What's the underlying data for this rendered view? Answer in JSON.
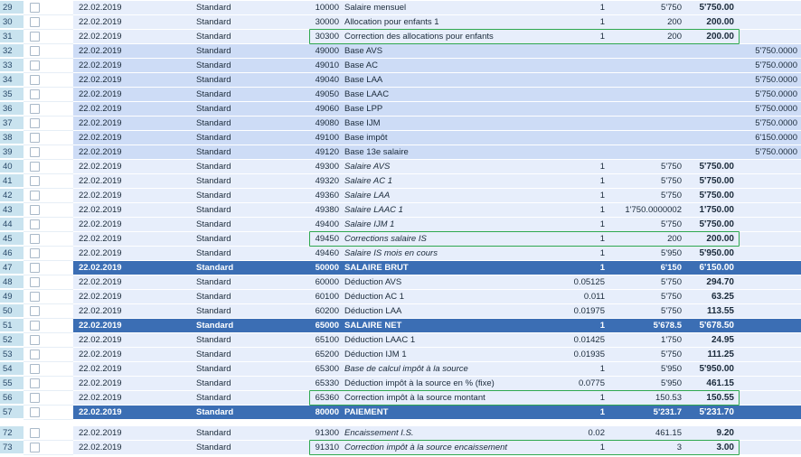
{
  "rows": [
    {
      "n": "29",
      "date": "22.02.2019",
      "type": "Standard",
      "code": "10000",
      "desc": "Salaire mensuel",
      "qty": "1",
      "rate": "5'750",
      "amt": "5'750.00",
      "base": "",
      "kind": "light",
      "italic": false,
      "hl": false
    },
    {
      "n": "30",
      "date": "22.02.2019",
      "type": "Standard",
      "code": "30000",
      "desc": "Allocation pour enfants 1",
      "qty": "1",
      "rate": "200",
      "amt": "200.00",
      "base": "",
      "kind": "light",
      "italic": false,
      "hl": false
    },
    {
      "n": "31",
      "date": "22.02.2019",
      "type": "Standard",
      "code": "30300",
      "desc": "Correction des allocations pour enfants",
      "qty": "1",
      "rate": "200",
      "amt": "200.00",
      "base": "",
      "kind": "light",
      "italic": false,
      "hl": true
    },
    {
      "n": "32",
      "date": "22.02.2019",
      "type": "Standard",
      "code": "49000",
      "desc": "Base AVS",
      "qty": "",
      "rate": "",
      "amt": "",
      "base": "5'750.0000",
      "kind": "blue",
      "italic": false,
      "hl": false
    },
    {
      "n": "33",
      "date": "22.02.2019",
      "type": "Standard",
      "code": "49010",
      "desc": "Base AC",
      "qty": "",
      "rate": "",
      "amt": "",
      "base": "5'750.0000",
      "kind": "blue",
      "italic": false,
      "hl": false
    },
    {
      "n": "34",
      "date": "22.02.2019",
      "type": "Standard",
      "code": "49040",
      "desc": "Base LAA",
      "qty": "",
      "rate": "",
      "amt": "",
      "base": "5'750.0000",
      "kind": "blue",
      "italic": false,
      "hl": false
    },
    {
      "n": "35",
      "date": "22.02.2019",
      "type": "Standard",
      "code": "49050",
      "desc": "Base LAAC",
      "qty": "",
      "rate": "",
      "amt": "",
      "base": "5'750.0000",
      "kind": "blue",
      "italic": false,
      "hl": false
    },
    {
      "n": "36",
      "date": "22.02.2019",
      "type": "Standard",
      "code": "49060",
      "desc": "Base LPP",
      "qty": "",
      "rate": "",
      "amt": "",
      "base": "5'750.0000",
      "kind": "blue",
      "italic": false,
      "hl": false
    },
    {
      "n": "37",
      "date": "22.02.2019",
      "type": "Standard",
      "code": "49080",
      "desc": "Base IJM",
      "qty": "",
      "rate": "",
      "amt": "",
      "base": "5'750.0000",
      "kind": "blue",
      "italic": false,
      "hl": false
    },
    {
      "n": "38",
      "date": "22.02.2019",
      "type": "Standard",
      "code": "49100",
      "desc": "Base impôt",
      "qty": "",
      "rate": "",
      "amt": "",
      "base": "6'150.0000",
      "kind": "blue",
      "italic": false,
      "hl": false
    },
    {
      "n": "39",
      "date": "22.02.2019",
      "type": "Standard",
      "code": "49120",
      "desc": "Base 13e salaire",
      "qty": "",
      "rate": "",
      "amt": "",
      "base": "5'750.0000",
      "kind": "blue",
      "italic": false,
      "hl": false
    },
    {
      "n": "40",
      "date": "22.02.2019",
      "type": "Standard",
      "code": "49300",
      "desc": "Salaire AVS",
      "qty": "1",
      "rate": "5'750",
      "amt": "5'750.00",
      "base": "",
      "kind": "light",
      "italic": true,
      "hl": false
    },
    {
      "n": "41",
      "date": "22.02.2019",
      "type": "Standard",
      "code": "49320",
      "desc": "Salaire AC 1",
      "qty": "1",
      "rate": "5'750",
      "amt": "5'750.00",
      "base": "",
      "kind": "light",
      "italic": true,
      "hl": false
    },
    {
      "n": "42",
      "date": "22.02.2019",
      "type": "Standard",
      "code": "49360",
      "desc": "Salaire LAA",
      "qty": "1",
      "rate": "5'750",
      "amt": "5'750.00",
      "base": "",
      "kind": "light",
      "italic": true,
      "hl": false
    },
    {
      "n": "43",
      "date": "22.02.2019",
      "type": "Standard",
      "code": "49380",
      "desc": "Salaire LAAC 1",
      "qty": "1",
      "rate": "1'750.0000002",
      "amt": "1'750.00",
      "base": "",
      "kind": "light",
      "italic": true,
      "hl": false
    },
    {
      "n": "44",
      "date": "22.02.2019",
      "type": "Standard",
      "code": "49400",
      "desc": "Salaire IJM 1",
      "qty": "1",
      "rate": "5'750",
      "amt": "5'750.00",
      "base": "",
      "kind": "light",
      "italic": true,
      "hl": false
    },
    {
      "n": "45",
      "date": "22.02.2019",
      "type": "Standard",
      "code": "49450",
      "desc": "Corrections salaire IS",
      "qty": "1",
      "rate": "200",
      "amt": "200.00",
      "base": "",
      "kind": "light",
      "italic": true,
      "hl": true
    },
    {
      "n": "46",
      "date": "22.02.2019",
      "type": "Standard",
      "code": "49460",
      "desc": "Salaire IS mois en cours",
      "qty": "1",
      "rate": "5'950",
      "amt": "5'950.00",
      "base": "",
      "kind": "light",
      "italic": true,
      "hl": false
    },
    {
      "n": "47",
      "date": "22.02.2019",
      "type": "Standard",
      "code": "50000",
      "desc": "SALAIRE BRUT",
      "qty": "1",
      "rate": "6'150",
      "amt": "6'150.00",
      "base": "",
      "kind": "total",
      "italic": false,
      "hl": false
    },
    {
      "n": "48",
      "date": "22.02.2019",
      "type": "Standard",
      "code": "60000",
      "desc": "Déduction AVS",
      "qty": "0.05125",
      "rate": "5'750",
      "amt": "294.70",
      "base": "",
      "kind": "light",
      "italic": false,
      "hl": false
    },
    {
      "n": "49",
      "date": "22.02.2019",
      "type": "Standard",
      "code": "60100",
      "desc": "Déduction AC 1",
      "qty": "0.011",
      "rate": "5'750",
      "amt": "63.25",
      "base": "",
      "kind": "light",
      "italic": false,
      "hl": false
    },
    {
      "n": "50",
      "date": "22.02.2019",
      "type": "Standard",
      "code": "60200",
      "desc": "Déduction LAA",
      "qty": "0.01975",
      "rate": "5'750",
      "amt": "113.55",
      "base": "",
      "kind": "light",
      "italic": false,
      "hl": false
    },
    {
      "n": "51",
      "date": "22.02.2019",
      "type": "Standard",
      "code": "65000",
      "desc": "SALAIRE NET",
      "qty": "1",
      "rate": "5'678.5",
      "amt": "5'678.50",
      "base": "",
      "kind": "total",
      "italic": false,
      "hl": false
    },
    {
      "n": "52",
      "date": "22.02.2019",
      "type": "Standard",
      "code": "65100",
      "desc": "Déduction LAAC 1",
      "qty": "0.01425",
      "rate": "1'750",
      "amt": "24.95",
      "base": "",
      "kind": "light",
      "italic": false,
      "hl": false
    },
    {
      "n": "53",
      "date": "22.02.2019",
      "type": "Standard",
      "code": "65200",
      "desc": "Déduction IJM 1",
      "qty": "0.01935",
      "rate": "5'750",
      "amt": "111.25",
      "base": "",
      "kind": "light",
      "italic": false,
      "hl": false
    },
    {
      "n": "54",
      "date": "22.02.2019",
      "type": "Standard",
      "code": "65300",
      "desc": "Base de calcul impôt à la source",
      "qty": "1",
      "rate": "5'950",
      "amt": "5'950.00",
      "base": "",
      "kind": "light",
      "italic": true,
      "hl": false
    },
    {
      "n": "55",
      "date": "22.02.2019",
      "type": "Standard",
      "code": "65330",
      "desc": "Déduction impôt à la source en % (fixe)",
      "qty": "0.0775",
      "rate": "5'950",
      "amt": "461.15",
      "base": "",
      "kind": "light",
      "italic": false,
      "hl": false
    },
    {
      "n": "56",
      "date": "22.02.2019",
      "type": "Standard",
      "code": "65360",
      "desc": "Correction impôt à la source montant",
      "qty": "1",
      "rate": "150.53",
      "amt": "150.55",
      "base": "",
      "kind": "light",
      "italic": false,
      "hl": true
    },
    {
      "n": "57",
      "date": "22.02.2019",
      "type": "Standard",
      "code": "80000",
      "desc": "PAIEMENT",
      "qty": "1",
      "rate": "5'231.7",
      "amt": "5'231.70",
      "base": "",
      "kind": "total",
      "italic": false,
      "hl": false
    },
    {
      "n": "72",
      "date": "22.02.2019",
      "type": "Standard",
      "code": "91300",
      "desc": "Encaissement I.S.",
      "qty": "0.02",
      "rate": "461.15",
      "amt": "9.20",
      "base": "",
      "kind": "light",
      "italic": true,
      "hl": false
    },
    {
      "n": "73",
      "date": "22.02.2019",
      "type": "Standard",
      "code": "91310",
      "desc": "Correction impôt à la source encaissement",
      "qty": "1",
      "rate": "3",
      "amt": "3.00",
      "base": "",
      "kind": "light",
      "italic": true,
      "hl": true
    }
  ],
  "colors": {
    "highlight": "#2fa84f",
    "total_row": "#3b6eb4",
    "base_row": "#cddcf6",
    "normal_row": "#e7eefb",
    "row_number": "#c9e3ef"
  }
}
